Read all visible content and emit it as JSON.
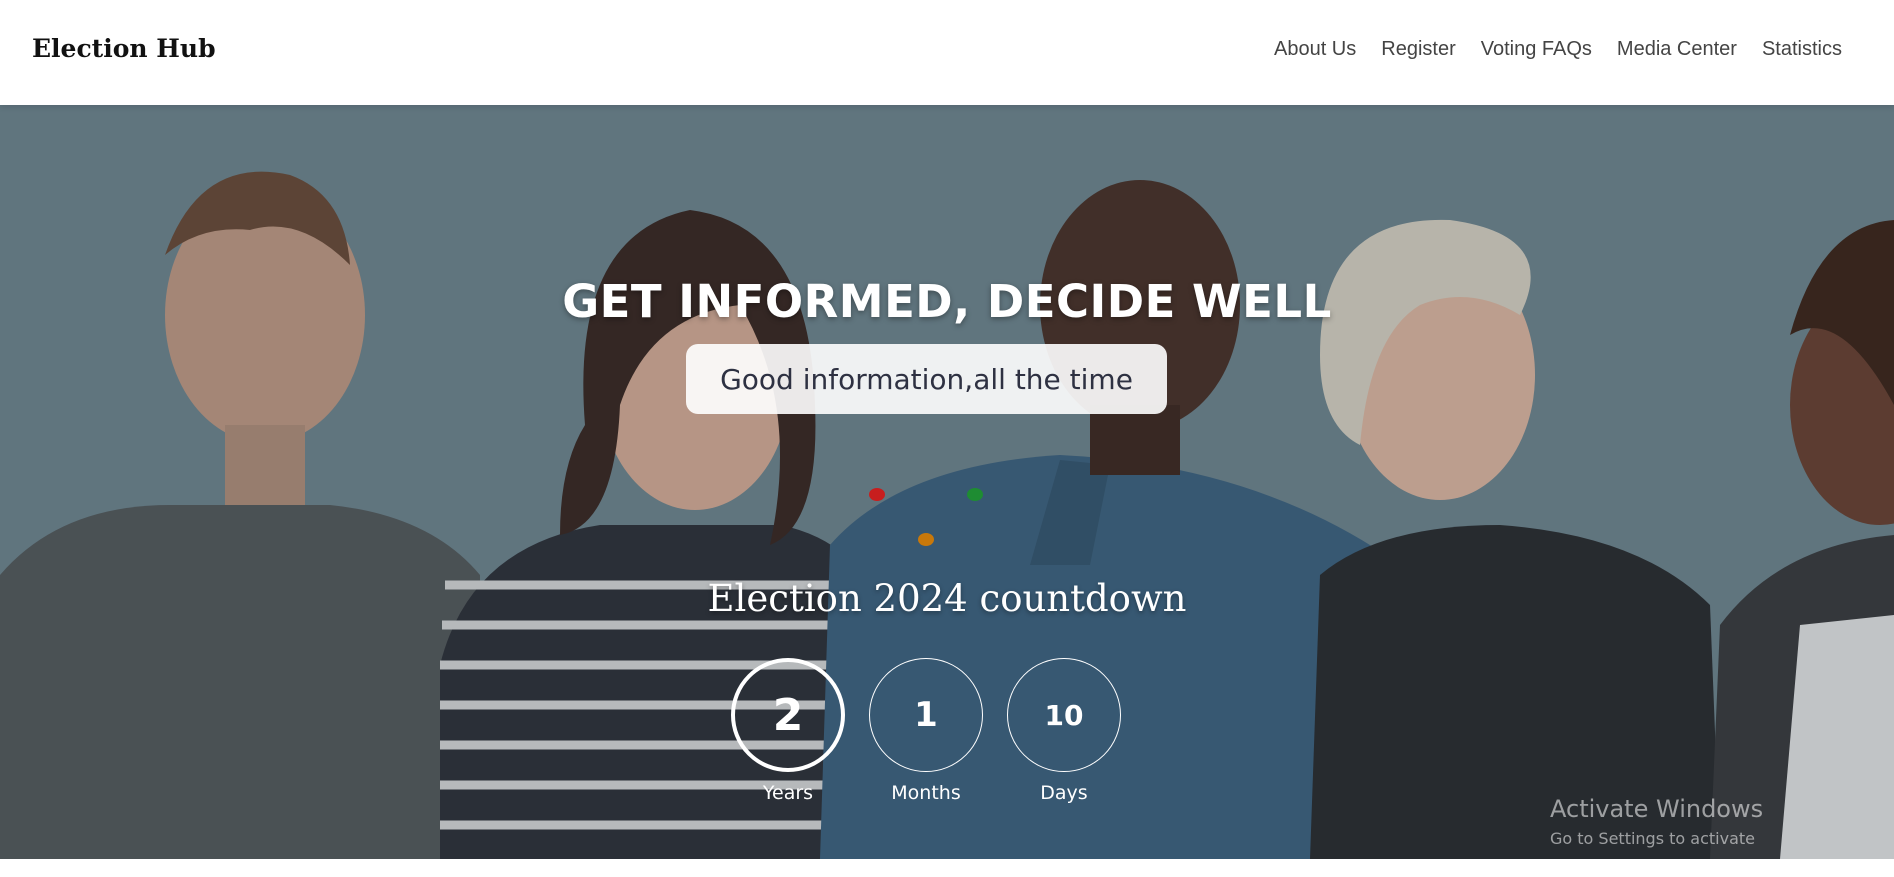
{
  "navbar": {
    "brand": "Election Hub",
    "links": [
      "About Us",
      "Register",
      "Voting FAQs",
      "Media Center",
      "Statistics"
    ]
  },
  "hero": {
    "title": "GET INFORMED, DECIDE WELL",
    "tagline": "Good information,all the time",
    "dot_colors": [
      "#c81e1e",
      "#1e8c32",
      "#c8780a"
    ],
    "countdown": {
      "title": "Election 2024 countdown",
      "units": [
        {
          "value": "2",
          "label": "Years"
        },
        {
          "value": "1",
          "label": "Months"
        },
        {
          "value": "10",
          "label": "Days"
        }
      ]
    }
  },
  "watermark": {
    "title": "Activate Windows",
    "subtitle": "Go to Settings to activate"
  },
  "colors": {
    "background_teal": "#6f858e",
    "white": "#ffffff"
  }
}
